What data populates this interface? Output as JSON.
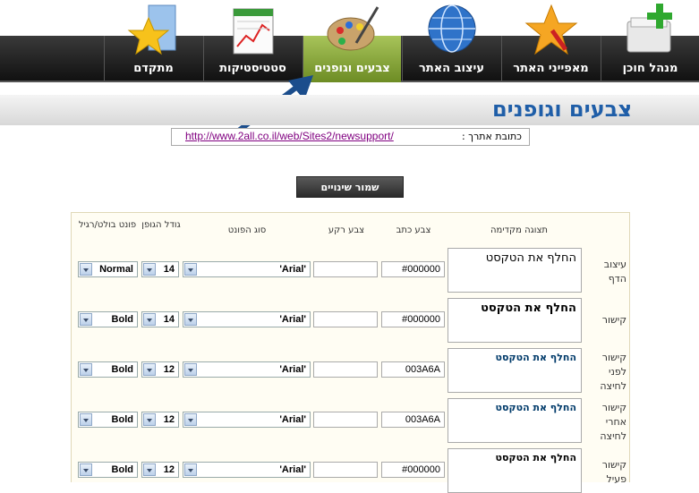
{
  "nav": {
    "items": [
      {
        "label": "מנהל חוכן",
        "icon": "add-content-icon"
      },
      {
        "label": "מאפייני האתר",
        "icon": "star-tools-icon"
      },
      {
        "label": "עיצוב האתר",
        "icon": "globe-icon"
      },
      {
        "label": "צבעים וגופנים",
        "icon": "palette-icon"
      },
      {
        "label": "סטטיסטיקות",
        "icon": "stats-chart-icon"
      },
      {
        "label": "מתקדם",
        "icon": "star-folder-icon"
      }
    ]
  },
  "page": {
    "title": "צבעים וגופנים",
    "site_url_label": "כתובת אתרך :",
    "site_url": "http://www.2all.co.il/web/Sites2/newsupport/",
    "save_label": "שמור שינויים"
  },
  "table": {
    "headers": {
      "preview": "תצוגה מקדימה",
      "text_color": "צבע כתב",
      "bg_color": "צבע רקע",
      "font_type": "סוג הפונט",
      "font_size": "גודל הגופן",
      "font_style": "פונט בולט/רגיל"
    },
    "rows": [
      {
        "label": "עיצוב הדף",
        "preview": "החלף את הטקסט",
        "text_color": "#000000",
        "bg_color": "",
        "font": "'Arial'",
        "size": "14",
        "style": "Normal"
      },
      {
        "label": "קישור",
        "preview": "החלף את הטקסט",
        "text_color": "#000000",
        "bg_color": "",
        "font": "'Arial'",
        "size": "14",
        "style": "Bold"
      },
      {
        "label": "קישור לפני לחיצה",
        "preview": "החלף את הטקסט",
        "text_color": "003A6A",
        "bg_color": "",
        "font": "'Arial'",
        "size": "12",
        "style": "Bold"
      },
      {
        "label": "קישור אחרי לחיצה",
        "preview": "החלף את הטקסט",
        "text_color": "003A6A",
        "bg_color": "",
        "font": "'Arial'",
        "size": "12",
        "style": "Bold"
      },
      {
        "label": "קישור פעיל",
        "preview": "החלף את הטקסט",
        "text_color": "#000000",
        "bg_color": "",
        "font": "'Arial'",
        "size": "12",
        "style": "Bold"
      }
    ]
  },
  "colors": {
    "accent": "#1f5ea8",
    "active_tab": "#8fb03e",
    "link_color": "#800080"
  }
}
